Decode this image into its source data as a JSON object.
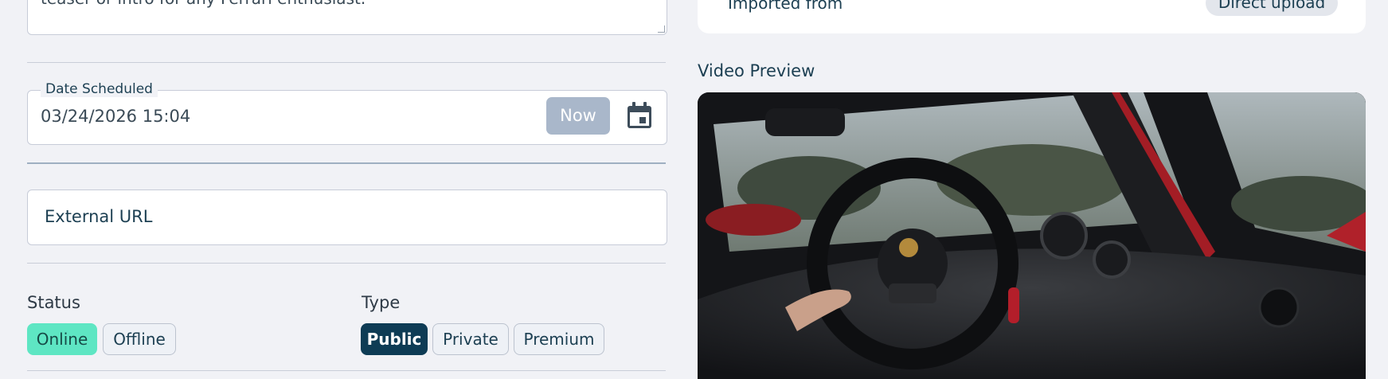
{
  "description": {
    "visible_text": "teaser or intro for any Ferrari enthusiast."
  },
  "date_scheduled": {
    "label": "Date Scheduled",
    "value": "03/24/2026 15:04",
    "now_label": "Now",
    "calendar_icon": "calendar-icon"
  },
  "external_url": {
    "placeholder": "External URL"
  },
  "status": {
    "label": "Status",
    "options": [
      "Online",
      "Offline"
    ],
    "selected": "Online"
  },
  "type": {
    "label": "Type",
    "options": [
      "Public",
      "Private",
      "Premium"
    ],
    "selected": "Public"
  },
  "info": {
    "imported_from_label": "Imported from",
    "imported_from_value": "Direct upload"
  },
  "video_preview": {
    "label": "Video Preview"
  },
  "colors": {
    "accent_dark": "#0e3c55",
    "online_green": "#5ee6c3",
    "now_button": "#a9b7ca",
    "background": "#f1f2f6"
  }
}
